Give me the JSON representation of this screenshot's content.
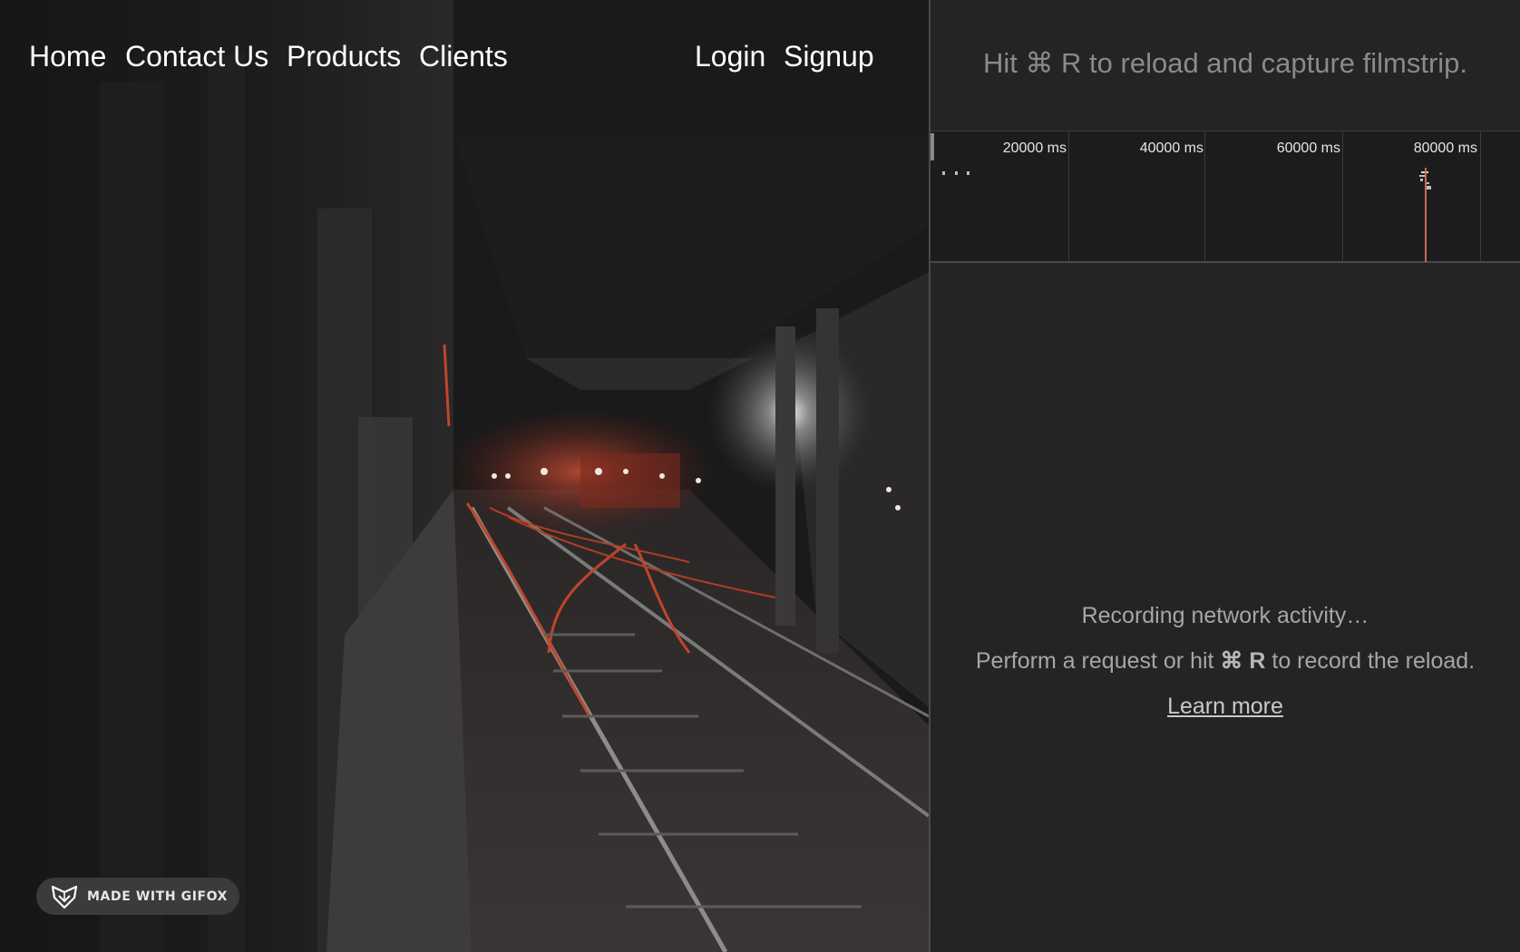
{
  "site": {
    "nav": {
      "home": "Home",
      "contact": "Contact Us",
      "products": "Products",
      "clients": "Clients",
      "login": "Login",
      "signup": "Signup"
    },
    "badge": {
      "label": "MADE WITH GIFOX",
      "icon": "fox-icon"
    },
    "hero_image": "subway-tunnel-tracks-photo"
  },
  "devtools": {
    "filmstrip_hint": "Hit ⌘ R to reload and capture filmstrip.",
    "timeline": {
      "ticks": [
        "20000 ms",
        "40000 ms",
        "60000 ms",
        "80000 ms"
      ]
    },
    "empty_state": {
      "recording": "Recording network activity…",
      "perform_prefix": "Perform a request or hit ",
      "shortcut": "⌘ R",
      "perform_suffix": " to record the reload.",
      "learn_more": "Learn more"
    }
  },
  "colors": {
    "panel_bg": "#242424",
    "overview_bg": "#1c1c1c",
    "muted_text": "#8a8a8a",
    "load_marker": "#c6695a",
    "track_red": "#c0452a"
  }
}
